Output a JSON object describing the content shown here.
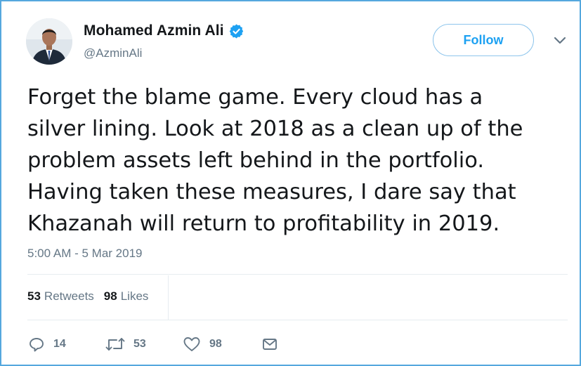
{
  "user": {
    "name": "Mohamed Azmin Ali",
    "handle": "@AzminAli",
    "verified": true
  },
  "follow_label": "Follow",
  "tweet": {
    "text": "Forget the blame game. Every cloud has a\nsilver lining. Look at 2018 as a clean up of the\nproblem assets left behind in the portfolio.\nHaving taken these measures, I dare say that\nKhazanah will return to profitability in 2019.",
    "timestamp": "5:00 AM - 5 Mar 2019"
  },
  "stats": {
    "retweets_count": "53",
    "retweets_label": "Retweets",
    "likes_count": "98",
    "likes_label": "Likes"
  },
  "actions": {
    "reply_count": "14",
    "retweet_count": "53",
    "like_count": "98"
  },
  "colors": {
    "accent": "#1da1f2",
    "frame_border": "#55a8de",
    "secondary_text": "#657786",
    "divider": "#e6ecf0"
  },
  "icons": [
    "verified-badge-icon",
    "chevron-down-icon",
    "reply-icon",
    "retweet-icon",
    "like-icon",
    "message-icon"
  ]
}
